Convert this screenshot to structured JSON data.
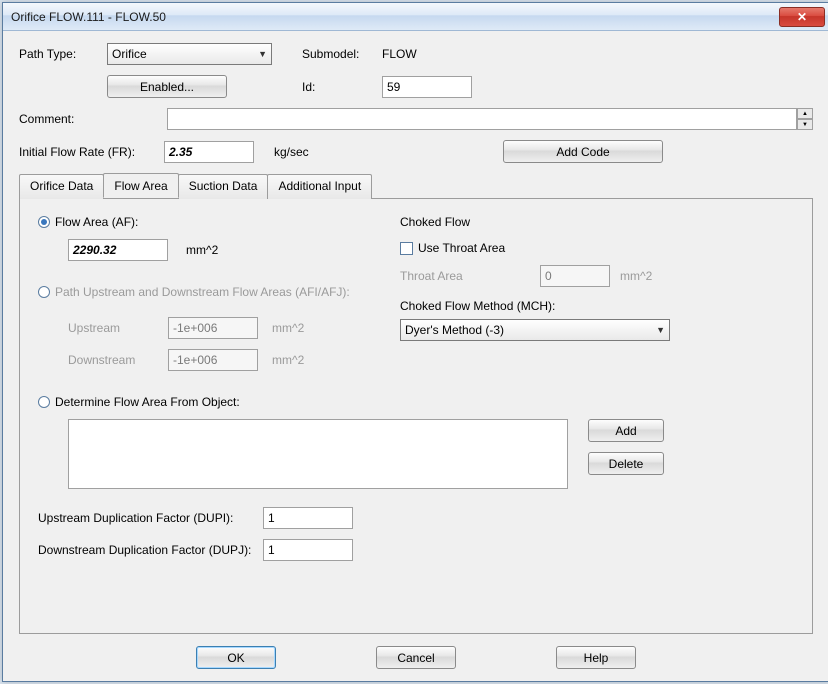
{
  "title": "Orifice FLOW.111 - FLOW.50",
  "row1": {
    "path_type_label": "Path Type:",
    "path_type_value": "Orifice",
    "submodel_label": "Submodel:",
    "submodel_value": "FLOW"
  },
  "row2": {
    "enabled_btn": "Enabled...",
    "id_label": "Id:",
    "id_value": "59"
  },
  "comment_label": "Comment:",
  "comment_value": "",
  "row3": {
    "flow_rate_label": "Initial Flow Rate (FR):",
    "flow_rate_value": "2.35",
    "flow_rate_unit": "kg/sec",
    "add_code_btn": "Add Code"
  },
  "tabs": [
    "Orifice Data",
    "Flow Area",
    "Suction Data",
    "Additional Input"
  ],
  "panel": {
    "flow_area_af": "Flow Area (AF):",
    "flow_area_value": "2290.32",
    "area_unit": "mm^2",
    "path_updown_label": "Path Upstream and Downstream Flow Areas (AFI/AFJ):",
    "upstream_label": "Upstream",
    "upstream_value": "-1e+006",
    "downstream_label": "Downstream",
    "downstream_value": "-1e+006",
    "determine_label": "Determine Flow Area From Object:",
    "add_btn": "Add",
    "delete_btn": "Delete",
    "dupi_label": "Upstream Duplication Factor (DUPI):",
    "dupi_value": "1",
    "dupj_label": "Downstream Duplication Factor (DUPJ):",
    "dupj_value": "1",
    "choked_flow_header": "Choked Flow",
    "use_throat_label": "Use Throat Area",
    "throat_area_label": "Throat Area",
    "throat_area_value": "0",
    "mch_label": "Choked Flow Method (MCH):",
    "mch_value": "Dyer's Method (-3)"
  },
  "footer": {
    "ok": "OK",
    "cancel": "Cancel",
    "help": "Help"
  }
}
